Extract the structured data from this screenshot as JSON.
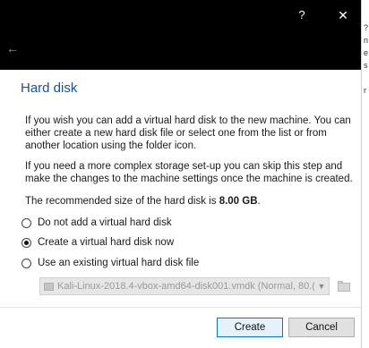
{
  "window": {
    "help_label": "?",
    "close_label": "✕",
    "back_label": "←"
  },
  "page": {
    "heading": "Hard disk",
    "para1": "If you wish you can add a virtual hard disk to the new machine. You can either create a new hard disk file or select one from the list or from another location using the folder icon.",
    "para2": "If you need a more complex storage set-up you can skip this step and make the changes to the machine settings once the machine is created.",
    "recommended_prefix": "The recommended size of the hard disk is ",
    "recommended_size": "8.00 GB",
    "recommended_suffix": "."
  },
  "options": [
    {
      "label": "Do not add a virtual hard disk",
      "selected": false
    },
    {
      "label": "Create a virtual hard disk now",
      "selected": true
    },
    {
      "label": "Use an existing virtual hard disk file",
      "selected": false
    }
  ],
  "existing_disk": {
    "value": "Kali-Linux-2018.4-vbox-amd64-disk001.vmdk (Normal, 80.(",
    "enabled": false
  },
  "buttons": {
    "create": "Create",
    "cancel": "Cancel"
  },
  "colors": {
    "heading": "#1a4f9a",
    "titlebar": "#000000",
    "primary_border": "#0078d7"
  },
  "icons": {
    "back": "arrow-left-icon",
    "close": "close-icon",
    "disk": "hard-disk-icon",
    "folder": "folder-icon"
  }
}
